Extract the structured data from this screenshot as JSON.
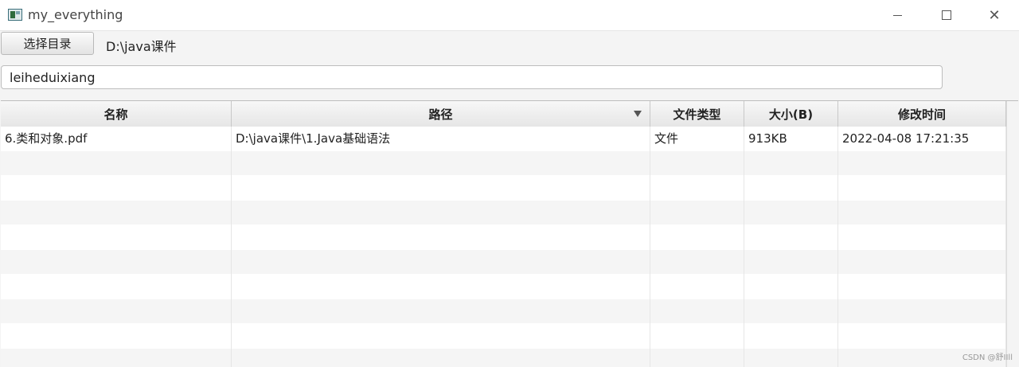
{
  "window": {
    "title": "my_everything",
    "icon": "app-window-icon",
    "controls": [
      "minimize-icon",
      "maximize-icon",
      "close-icon"
    ]
  },
  "toolbar": {
    "choose_dir_label": "选择目录",
    "current_dir": "D:\\java课件"
  },
  "search": {
    "value": "leiheduixiang",
    "placeholder": ""
  },
  "table": {
    "columns": [
      "名称",
      "路径",
      "文件类型",
      "大小(B)",
      "修改时间"
    ],
    "sorted_column": "路径",
    "rows": [
      {
        "name": "6.类和对象.pdf",
        "path": "D:\\java课件\\1.Java基础语法",
        "type": "文件",
        "size": "913KB",
        "modified": "2022-04-08 17:21:35"
      }
    ]
  },
  "watermark": "CSDN @舒IIll"
}
